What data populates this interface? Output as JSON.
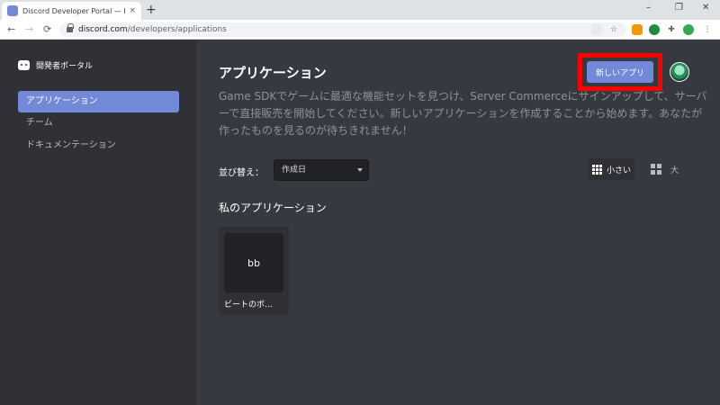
{
  "browser": {
    "tab_title": "Discord Developer Portal — My Applications",
    "tab_close": "×",
    "new_tab": "+",
    "win_min": "–",
    "win_max": "❐",
    "win_close": "✕",
    "back": "←",
    "forward": "→",
    "reload": "⟳",
    "url_host": "discord.com",
    "url_path": "/developers/applications",
    "icons": [
      "translate-icon",
      "star-icon",
      "extension-orange-icon",
      "shield-green-icon",
      "puzzle-icon",
      "profile-icon",
      "menu-icon"
    ]
  },
  "sidebar": {
    "brand": "開発者ポータル",
    "items": [
      {
        "label": "アプリケーション",
        "active": true
      },
      {
        "label": "チーム",
        "active": false
      },
      {
        "label": "ドキュメンテーション",
        "active": false
      }
    ]
  },
  "main": {
    "title": "アプリケーション",
    "new_app_label": "新しいアプリ",
    "description": "Game SDKでゲームに最適な機能セットを見つけ、Server Commerceにサインアップして、サーバーで直接販売を開始してください。新しいアプリケーションを作成することから始めます。あなたが作ったものを見るのが待ちきれません！",
    "sort_label": "並び替え：",
    "sort_value": "作成日",
    "view_small_label": "小さい",
    "view_large_label": "大",
    "section_title": "私のアプリケーション",
    "apps": [
      {
        "icon_text": "bb",
        "name": "ビートのボ..."
      }
    ]
  },
  "colors": {
    "accent": "#7289da",
    "highlight": "#ff0000"
  }
}
